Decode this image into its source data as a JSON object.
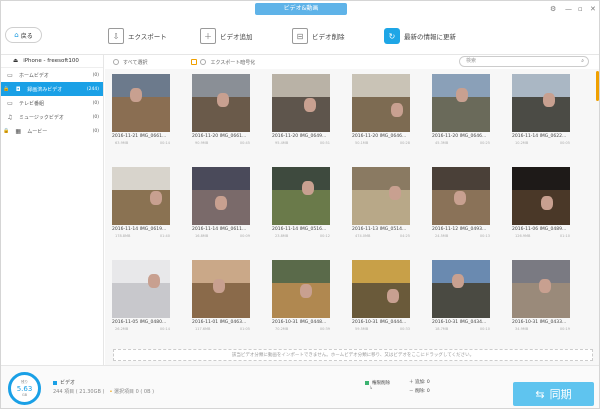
{
  "window": {
    "title": "ビデオ&動画"
  },
  "toolbar": {
    "back_label": "戻る",
    "export_label": "エクスポート",
    "add_label": "ビデオ追加",
    "delete_label": "ビデオ削除",
    "refresh_label": "最新の情報に更新"
  },
  "sidebar": {
    "device_name": "iPhone - freesoft100",
    "items": [
      {
        "label": "ホームビデオ",
        "count": "(0)",
        "icon": "video-icon",
        "locked": false,
        "selected": false
      },
      {
        "label": "録画済みビデオ",
        "count": "(244)",
        "icon": "camera-icon",
        "locked": true,
        "selected": true
      },
      {
        "label": "テレビ番組",
        "count": "(0)",
        "icon": "tv-icon",
        "locked": false,
        "selected": false
      },
      {
        "label": "ミュージックビデオ",
        "count": "(0)",
        "icon": "music-video-icon",
        "locked": false,
        "selected": false
      },
      {
        "label": "ムービー",
        "count": "(0)",
        "icon": "film-icon",
        "locked": true,
        "selected": false
      }
    ]
  },
  "filter": {
    "select_all": "すべて選択",
    "export_encrypt": "エクスポート暗号化",
    "search_placeholder": "検索"
  },
  "videos": [
    {
      "name": "2016-11-21 IMG_0661...",
      "size": "63.9MB",
      "duration": "00:14"
    },
    {
      "name": "2016-11-20 IMG_0661...",
      "size": "90.9MB",
      "duration": "00:45"
    },
    {
      "name": "2016-11-20 IMG_0649...",
      "size": "95.4MB",
      "duration": "00:51"
    },
    {
      "name": "2016-11-20 IMG_0646...",
      "size": "50.1MB",
      "duration": "00:28"
    },
    {
      "name": "2016-11-20 IMG_0646...",
      "size": "45.3MB",
      "duration": "00:25"
    },
    {
      "name": "2016-11-14 IMG_0622...",
      "size": "10.2MB",
      "duration": "00:05"
    },
    {
      "name": "2016-11-14 IMG_0619...",
      "size": "178.8MB",
      "duration": "01:40"
    },
    {
      "name": "2016-11-14 IMG_0611...",
      "size": "16.8MB",
      "duration": "00:09"
    },
    {
      "name": "2016-11-14 IMG_0516...",
      "size": "23.8MB",
      "duration": "00:12"
    },
    {
      "name": "2016-11-13 IMG_0514...",
      "size": "474.0MB",
      "duration": "04:25"
    },
    {
      "name": "2016-11-12 IMG_0493...",
      "size": "24.5MB",
      "duration": "00:13"
    },
    {
      "name": "2016-11-06 IMG_0489...",
      "size": "126.9MB",
      "duration": "01:10"
    },
    {
      "name": "2016-11-05 IMG_0480...",
      "size": "26.2MB",
      "duration": "00:14"
    },
    {
      "name": "2016-11-01 IMG_0463...",
      "size": "117.6MB",
      "duration": "01:05"
    },
    {
      "name": "2016-10-31 IMG_0448...",
      "size": "70.2MB",
      "duration": "00:39"
    },
    {
      "name": "2016-10-31 IMG_0444...",
      "size": "59.5MB",
      "duration": "00:33"
    },
    {
      "name": "2016-10-31 IMG_0434...",
      "size": "18.7MB",
      "duration": "00:10"
    },
    {
      "name": "2016-10-31 IMG_0433...",
      "size": "34.9MB",
      "duration": "00:19"
    }
  ],
  "hint": "該当ビデオ分類に動画をインポートできません。ホームビデオ分類に移り、又はビデオをここにドラッグしてください。",
  "bottom": {
    "gauge_label": "残り",
    "gauge_value": "5.63",
    "gauge_unit": "GB",
    "category": "ビデオ",
    "items_summary": "244 項目 ( 21.30GB )",
    "selected_summary": "選択項目 0 ( 0B )",
    "sync_legend_label": "権限削除",
    "add_label": "追加: 0",
    "delete_label": "削除: 0",
    "sync_button": "同期"
  },
  "colors": {
    "accent": "#1aa0e6",
    "lock": "#f0a000",
    "sync": "#5fc4ef"
  }
}
